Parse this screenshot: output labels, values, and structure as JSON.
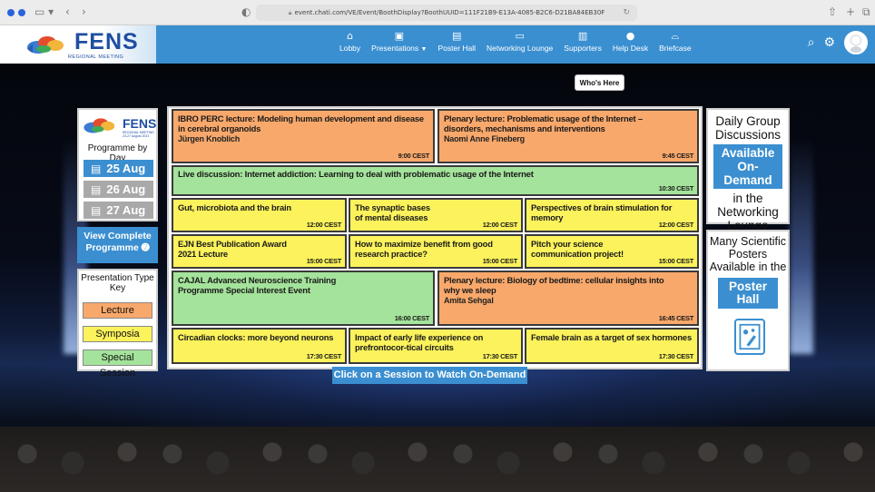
{
  "browser": {
    "url": "event.chati.com/VE/Event/BoothDisplay?BoothUUID=111F21B9-E13A-4085-B2C6-D21BA84EB30F"
  },
  "header": {
    "logo_word": "FENS",
    "logo_sub": "REGIONAL MEETING",
    "nav": [
      {
        "label": "Lobby",
        "icon": "home-icon"
      },
      {
        "label": "Presentations",
        "icon": "presentation-icon"
      },
      {
        "label": "Poster Hall",
        "icon": "poster-hall-icon"
      },
      {
        "label": "Networking Lounge",
        "icon": "chat-icon"
      },
      {
        "label": "Supporters",
        "icon": "building-icon"
      },
      {
        "label": "Help Desk",
        "icon": "help-icon"
      },
      {
        "label": "Briefcase",
        "icon": "briefcase-icon"
      }
    ]
  },
  "whos_here": "Who's Here",
  "left_panel": {
    "logo_word": "FENS",
    "logo_sub": "REGIONAL MEETING 23-27 August 2021",
    "programme_by_day": "Programme by Day",
    "days": [
      "25 Aug",
      "26 Aug",
      "27 Aug"
    ],
    "view_complete_line1": "View Complete",
    "view_complete_line2": "Programme ➋",
    "key_title": "Presentation Type Key",
    "key": [
      "Lecture",
      "Symposia",
      "Special Session"
    ]
  },
  "sessions": [
    {
      "title": "IBRO PERC lecture: Modeling human development and disease in cerebral organoids",
      "speaker": "Jürgen Knoblich",
      "time": "9:00 CEST"
    },
    {
      "title": "Plenary lecture: Problematic usage of the Internet – disorders, mechanisms and interventions",
      "speaker": "Naomi Anne Fineberg",
      "time": "9:45 CEST"
    },
    {
      "title": "Live discussion:  Internet addiction: Learning to deal with problematic usage of the Internet",
      "speaker": "",
      "time": "10:30 CEST"
    },
    {
      "title": "Gut, microbiota and the brain",
      "speaker": "",
      "time": "12:00 CEST"
    },
    {
      "title": "The synaptic bases of mental diseases",
      "speaker": "",
      "time": "12:00 CEST"
    },
    {
      "title": "Perspectives of brain stimulation for memory",
      "speaker": "",
      "time": "12:00 CEST"
    },
    {
      "title": "EJN Best Publication Award 2021 Lecture",
      "speaker": "",
      "time": "15:00 CEST"
    },
    {
      "title": "How to maximize benefit from good research practice?",
      "speaker": "",
      "time": "15:00 CEST"
    },
    {
      "title": "Pitch your science communication project!",
      "speaker": "",
      "time": "15:00 CEST"
    },
    {
      "title": "CAJAL Advanced Neuroscience Training Programme Special Interest Event",
      "speaker": "",
      "time": "16:00 CEST"
    },
    {
      "title": "Plenary lecture: Biology of bedtime: cellular insights into why we sleep",
      "speaker": "Amita Sehgal",
      "time": "16:45 CEST"
    },
    {
      "title": "Circadian clocks: more beyond neurons",
      "speaker": "",
      "time": "17:30 CEST"
    },
    {
      "title": "Impact of early life experience on prefrontocor-tical circuits",
      "speaker": "",
      "time": "17:30 CEST"
    },
    {
      "title": "Female brain as a target of sex hormones",
      "speaker": "",
      "time": "17:30 CEST"
    }
  ],
  "right_panel": {
    "daily_line1": "Daily Group",
    "daily_line2": "Discussions",
    "daily_hl": "Available On-Demand",
    "daily_line3": "in the",
    "daily_line4": "Networking",
    "daily_line5": "Lounge",
    "posters_line1": "Many Scientific",
    "posters_line2": "Posters",
    "posters_line3": "Available in the",
    "posters_hl": "Poster Hall"
  },
  "click_banner": "Click on a Session to Watch On-Demand",
  "colors": {
    "lecture": "#f8a86b",
    "symposia": "#fbf25c",
    "special": "#a4e39b",
    "accent": "#3b8fd0"
  }
}
